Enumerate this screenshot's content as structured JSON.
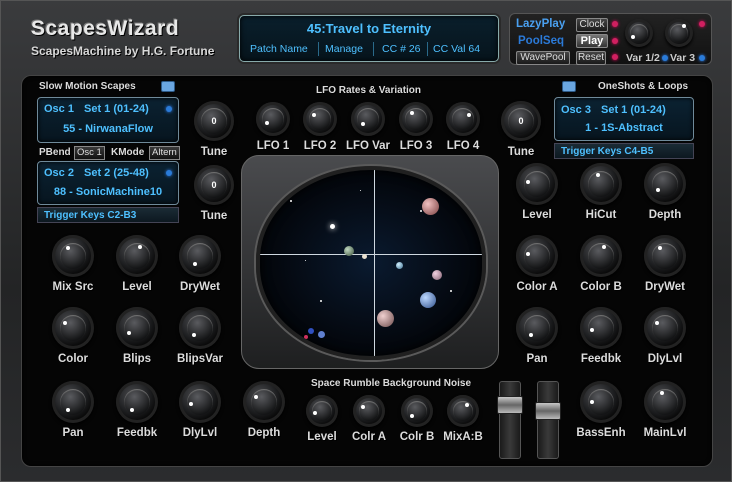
{
  "header": {
    "logo": "ScapesWizard",
    "subtitle": "ScapesMachine by H.G. Fortune",
    "patch_name": "45:Travel to Eternity",
    "buttons": {
      "patch_name": "Patch Name",
      "manage": "Manage",
      "cc": "CC # 26",
      "cc_val": "CC Val 64"
    }
  },
  "controls": {
    "lazyplay": "LazyPlay",
    "poolseq": "PoolSeq",
    "wavepool": "WavePool",
    "clock": "Clock",
    "play": "Play",
    "reset": "Reset",
    "var12": "Var 1/2",
    "var3": "Var 3"
  },
  "slow_motion": {
    "title": "Slow Motion Scapes",
    "osc1": {
      "label": "Osc 1",
      "set": "Set 1 (01-24)",
      "patch": "55 - NirwanaFlow"
    },
    "pbend": "PBend",
    "pbend_val": "Osc 1",
    "kmode": "KMode",
    "kmode_val": "Altern",
    "osc2": {
      "label": "Osc 2",
      "set": "Set 2 (25-48)",
      "patch": "88 - SonicMachine10"
    },
    "trigger": "Trigger Keys C2-B3",
    "tune1": "Tune",
    "tune1_val": "0",
    "tune2": "Tune",
    "tune2_val": "0"
  },
  "lfo": {
    "title": "LFO Rates & Variation",
    "knobs": [
      "LFO 1",
      "LFO 2",
      "LFO Var",
      "LFO 3",
      "LFO 4"
    ],
    "tune": "Tune",
    "tune_val": "0"
  },
  "oneshots": {
    "title": "OneShots & Loops",
    "osc3": {
      "label": "Osc 3",
      "set": "Set 1 (01-24)",
      "patch": "1 - 1S-Abstract"
    },
    "trigger": "Trigger Keys C4-B5",
    "knobs_row1": [
      "Level",
      "HiCut",
      "Depth"
    ],
    "knobs_row2": [
      "Color A",
      "Color B",
      "DryWet"
    ],
    "knobs_row3": [
      "Pan",
      "Feedbk",
      "DlyLvl"
    ],
    "knobs_row4": [
      "BassEnh",
      "MainLvl"
    ]
  },
  "left_knobs": {
    "row1": [
      "Mix Src",
      "Level",
      "DryWet"
    ],
    "row2": [
      "Color",
      "Blips",
      "BlipsVar"
    ],
    "row3": [
      "Pan",
      "Feedbk",
      "DlyLvl"
    ],
    "depth": "Depth"
  },
  "noise": {
    "title": "Space Rumble Background Noise",
    "knobs": [
      "Level",
      "Colr A",
      "Colr B",
      "MixA:B"
    ]
  }
}
